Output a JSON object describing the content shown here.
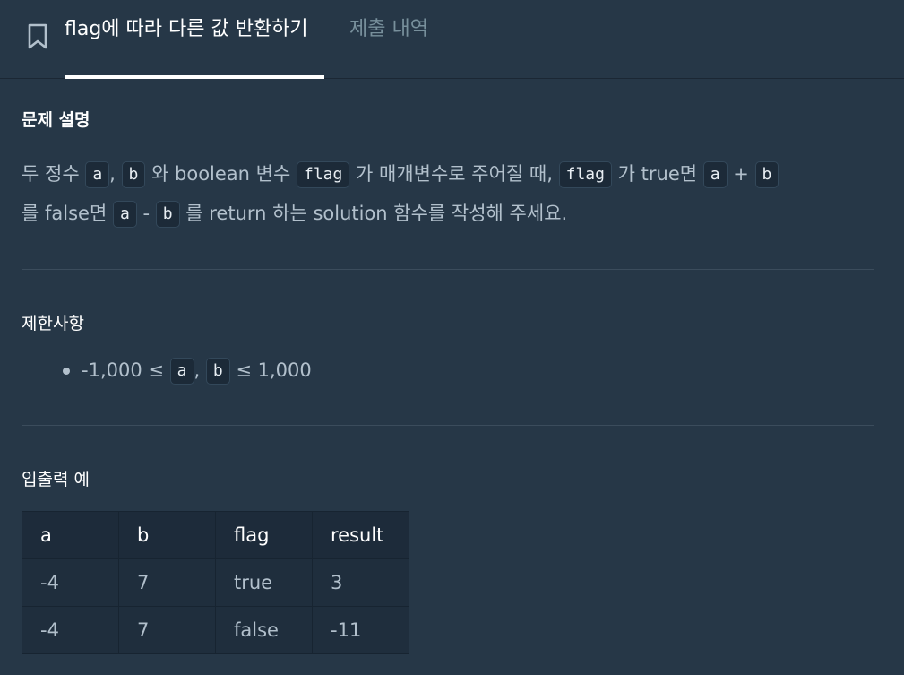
{
  "header": {
    "title_tab": "flag에 따라 다른 값 반환하기",
    "history_tab": "제출 내역"
  },
  "description": {
    "heading": "문제 설명",
    "line1": {
      "t1": "두 정수 ",
      "c_a": "a",
      "t2": ", ",
      "c_b": "b",
      "t3": " 와 boolean 변수 ",
      "c_flag": "flag",
      "t4": " 가 매개변수로 주어질 때, ",
      "c_flag2": "flag",
      "t5": " 가 true면 ",
      "c_a2": "a",
      "t6": " + ",
      "c_b2": "b"
    },
    "line2": {
      "t1": "를 false면 ",
      "c_a": "a",
      "t2": " - ",
      "c_b": "b",
      "t3": " 를 return 하는 solution 함수를 작성해 주세요."
    }
  },
  "constraints": {
    "heading": "제한사항",
    "item": {
      "t1": "-1,000 ≤ ",
      "c_a": "a",
      "t2": ", ",
      "c_b": "b",
      "t3": " ≤ 1,000"
    }
  },
  "examples": {
    "heading": "입출력 예",
    "columns": [
      "a",
      "b",
      "flag",
      "result"
    ],
    "rows": [
      [
        "-4",
        "7",
        "true",
        "3"
      ],
      [
        "-4",
        "7",
        "false",
        "-11"
      ]
    ]
  },
  "colors": {
    "background": "#263747",
    "code_bg": "#1c2a38",
    "text": "#b2c0cc",
    "muted_tab": "#78909c"
  }
}
